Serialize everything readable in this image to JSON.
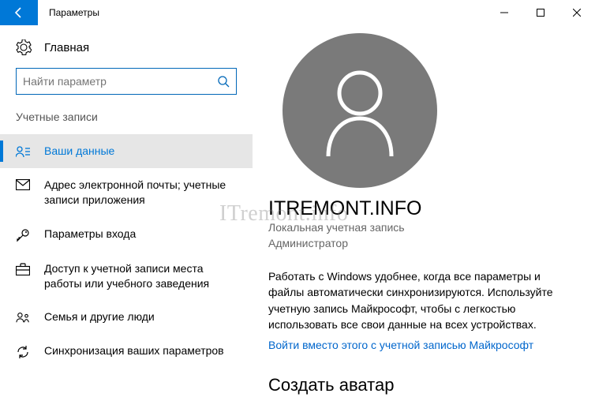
{
  "titlebar": {
    "title": "Параметры"
  },
  "home_label": "Главная",
  "search": {
    "placeholder": "Найти параметр"
  },
  "category": "Учетные записи",
  "nav": [
    {
      "label": "Ваши данные",
      "name": "sidebar-item-your-info",
      "selected": true
    },
    {
      "label": "Адрес электронной почты; учетные записи приложения",
      "name": "sidebar-item-email-accounts"
    },
    {
      "label": "Параметры входа",
      "name": "sidebar-item-signin-options"
    },
    {
      "label": "Доступ к учетной записи места работы или учебного заведения",
      "name": "sidebar-item-work-school"
    },
    {
      "label": "Семья и другие люди",
      "name": "sidebar-item-family"
    },
    {
      "label": "Синхронизация ваших параметров",
      "name": "sidebar-item-sync"
    }
  ],
  "profile": {
    "name": "ITREMONT.INFO",
    "type": "Локальная учетная запись",
    "role": "Администратор",
    "description": "Работать с Windows удобнее, когда все параметры и файлы автоматически синхронизируются. Используйте учетную запись Майкрософт, чтобы с легкостью использовать все свои данные на всех устройствах.",
    "signin_link": "Войти вместо этого с учетной записью Майкрософт",
    "avatar_section": "Создать аватар"
  },
  "watermark": "ITremont.info"
}
